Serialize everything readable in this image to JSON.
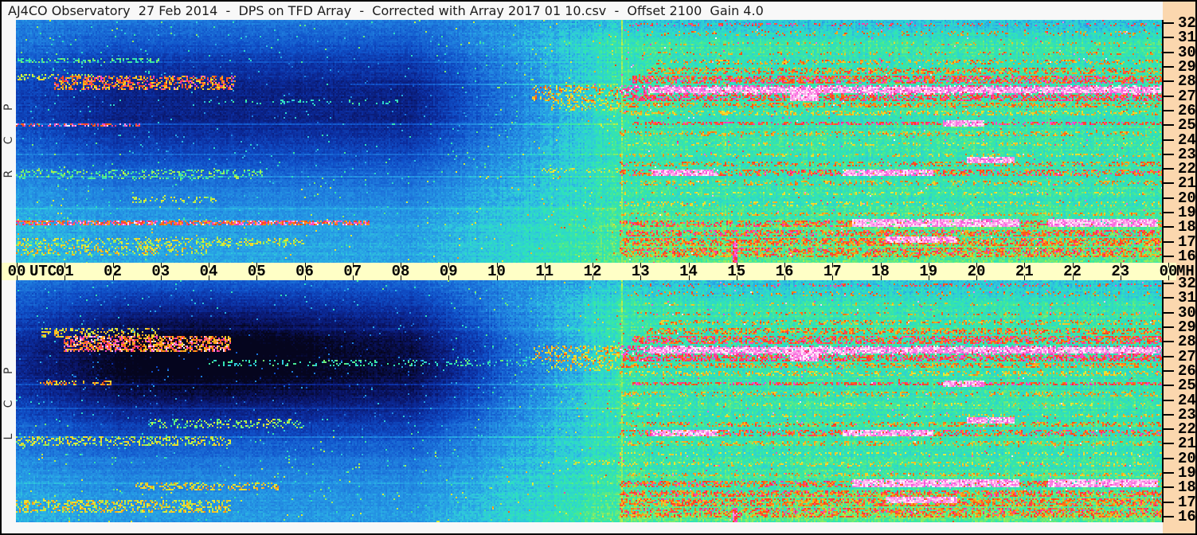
{
  "window": {
    "title": "AJ4CO Observatory  27 Feb 2014  -  DPS on TFD Array  -  Corrected with Array 2017 01 10.csv  -  Offset 2100  Gain 4.0"
  },
  "time_axis": {
    "utc_label": "UTC",
    "hour_labels": [
      "00",
      "01",
      "02",
      "03",
      "04",
      "05",
      "06",
      "07",
      "08",
      "09",
      "10",
      "11",
      "12",
      "13",
      "14",
      "15",
      "16",
      "17",
      "18",
      "19",
      "20",
      "21",
      "22",
      "23",
      "00"
    ]
  },
  "freq_axis": {
    "unit_label": "MHz",
    "tick_labels": [
      "32",
      "31",
      "30",
      "29",
      "28",
      "27",
      "26",
      "25",
      "24",
      "23",
      "22",
      "21",
      "20",
      "19",
      "18",
      "17",
      "16"
    ]
  },
  "colors": {
    "border": "#000000",
    "page_bg": "#f8f8f8",
    "time_band_bg": "#ffffc6",
    "right_margin_bg": "#fbd7ae",
    "axis_text": "#000000",
    "title_text": "#1c1c1c"
  },
  "chart_data": {
    "type": "heatmap",
    "title": "Dual-polarization dynamic power spectrum, 16-32 MHz over 24 h UTC",
    "date": "27 Feb 2014",
    "x": {
      "label": "UTC",
      "min_hours": 0,
      "max_hours": 24,
      "tick_step_hours": 1
    },
    "y": {
      "label": "MHz",
      "min": 16,
      "max": 32,
      "tick_step": 1
    },
    "colormap": [
      [
        0,
        "#05051e"
      ],
      [
        0.08,
        "#0a1464"
      ],
      [
        0.16,
        "#0c2d9e"
      ],
      [
        0.24,
        "#1050c8"
      ],
      [
        0.32,
        "#1e78dc"
      ],
      [
        0.4,
        "#28a0e6"
      ],
      [
        0.46,
        "#30c8dc"
      ],
      [
        0.52,
        "#2ee0c0"
      ],
      [
        0.57,
        "#3ce89e"
      ],
      [
        0.62,
        "#7aec6e"
      ],
      [
        0.67,
        "#b4ee4a"
      ],
      [
        0.72,
        "#e8ee38"
      ],
      [
        0.77,
        "#f8d028"
      ],
      [
        0.82,
        "#fca41e"
      ],
      [
        0.86,
        "#fc7014"
      ],
      [
        0.9,
        "#fc3c1e"
      ],
      [
        0.93,
        "#f83ca0"
      ],
      [
        0.96,
        "#fa50d8"
      ],
      [
        1,
        "#ffffff"
      ]
    ],
    "night_ionosphere": {
      "fade_in_end_utc": 2.2,
      "flat_end_utc": 8.3,
      "fade_out_end_utc": 12.62,
      "freq_center_mhz": 26.5,
      "freq_width_mhz": 5.5
    },
    "vertical_line_utc": 12.68,
    "rfi_bands": [
      [
        31.9,
        0.15,
        0.22,
        0.85,
        0.95,
        12.8
      ],
      [
        31.3,
        0.12,
        0.14,
        0.78,
        0.9,
        12.8
      ],
      [
        30.6,
        0.12,
        0.12,
        0.75,
        0.88,
        13.0
      ],
      [
        29.9,
        0.12,
        0.18,
        0.78,
        0.9,
        13.0
      ],
      [
        29.3,
        0.15,
        0.3,
        0.75,
        0.9,
        13.4
      ],
      [
        28.75,
        0.2,
        0.45,
        0.78,
        0.92,
        13.2
      ],
      [
        28.15,
        0.3,
        0.6,
        0.82,
        0.96,
        12.9
      ],
      [
        27.4,
        0.3,
        0.5,
        0.9,
        1.0,
        12.62
      ],
      [
        26.9,
        0.2,
        0.6,
        0.85,
        0.96,
        12.7
      ],
      [
        26.35,
        0.18,
        0.45,
        0.78,
        0.9,
        12.62
      ],
      [
        25.8,
        0.15,
        0.35,
        0.72,
        0.85,
        12.62
      ],
      [
        25.15,
        0.12,
        0.5,
        0.85,
        0.96,
        12.9
      ],
      [
        24.45,
        0.15,
        0.3,
        0.75,
        0.88,
        12.62
      ],
      [
        23.7,
        0.12,
        0.2,
        0.7,
        0.82,
        12.62
      ],
      [
        22.9,
        0.12,
        0.25,
        0.72,
        0.85,
        12.62
      ],
      [
        22.35,
        0.15,
        0.35,
        0.78,
        0.92,
        12.62
      ],
      [
        21.7,
        0.2,
        0.45,
        0.8,
        0.95,
        12.62
      ],
      [
        21.05,
        0.15,
        0.3,
        0.75,
        0.88,
        12.62
      ],
      [
        20.3,
        0.12,
        0.2,
        0.7,
        0.8,
        12.62
      ],
      [
        19.6,
        0.12,
        0.2,
        0.72,
        0.82,
        12.62
      ],
      [
        18.9,
        0.15,
        0.3,
        0.75,
        0.88,
        12.62
      ],
      [
        18.25,
        0.2,
        0.5,
        0.8,
        0.95,
        12.62
      ],
      [
        17.6,
        0.25,
        0.55,
        0.8,
        0.95,
        12.62
      ],
      [
        17.0,
        0.25,
        0.6,
        0.78,
        0.93,
        12.62
      ],
      [
        16.4,
        0.2,
        0.5,
        0.8,
        0.95,
        12.62
      ],
      [
        16.05,
        0.15,
        0.5,
        0.78,
        0.92,
        12.62
      ]
    ],
    "white_segments": [
      [
        27.4,
        13.25,
        23.97
      ],
      [
        21.75,
        13.3,
        14.7
      ],
      [
        21.75,
        17.3,
        19.2
      ],
      [
        18.3,
        17.5,
        21.0
      ],
      [
        18.3,
        21.6,
        23.9
      ],
      [
        17.15,
        18.2,
        19.7
      ],
      [
        22.6,
        19.9,
        20.9
      ],
      [
        25.1,
        19.4,
        20.25
      ],
      [
        26.9,
        16.2,
        16.8
      ]
    ],
    "panels": [
      {
        "name": "RCP",
        "label": "R C P",
        "seed": 1234567,
        "night_depth": 0.42,
        "extra_core_depth": 0,
        "lines": [
          [
            25.05,
            0,
            12.6,
            0.1
          ],
          [
            21.5,
            0,
            12.6,
            0.08
          ],
          [
            23.0,
            0,
            12.6,
            0.05
          ],
          [
            27.75,
            7,
            12.6,
            0.08
          ],
          [
            29.35,
            0,
            12.6,
            0.05
          ],
          [
            19.3,
            0,
            12.6,
            0.05
          ]
        ],
        "streaks": [
          [
            27.9,
            0.5,
            0.8,
            4.6,
            0.5,
            0.72,
            0.97
          ],
          [
            28.3,
            0.25,
            0.0,
            1.6,
            0.3,
            0.6,
            0.8
          ],
          [
            25.0,
            0.12,
            0.0,
            2.6,
            0.5,
            0.85,
            1.0
          ],
          [
            21.6,
            0.3,
            0.0,
            5.2,
            0.28,
            0.5,
            0.68
          ],
          [
            18.3,
            0.14,
            0.0,
            7.4,
            0.7,
            0.8,
            1.0
          ],
          [
            17.0,
            0.3,
            0.0,
            6.0,
            0.3,
            0.6,
            0.8
          ],
          [
            16.4,
            0.3,
            0.0,
            4.0,
            0.3,
            0.6,
            0.85
          ],
          [
            19.9,
            0.2,
            2.4,
            4.2,
            0.25,
            0.6,
            0.75
          ],
          [
            29.4,
            0.15,
            0.0,
            3.0,
            0.35,
            0.5,
            0.65
          ],
          [
            26.6,
            0.2,
            4.0,
            8.0,
            0.12,
            0.45,
            0.6
          ],
          [
            27.2,
            0.5,
            10.8,
            12.62,
            0.35,
            0.68,
            0.9
          ],
          [
            26.3,
            0.35,
            11.2,
            12.62,
            0.3,
            0.65,
            0.85
          ],
          [
            21.9,
            0.2,
            11.0,
            12.62,
            0.25,
            0.6,
            0.8
          ]
        ],
        "burst": [
          15.05,
          0.05,
          17.0
        ]
      },
      {
        "name": "LCP",
        "label": "L C P",
        "seed": 7654321,
        "night_depth": 0.5,
        "extra_core_depth": 0.1,
        "lines": [
          [
            25.05,
            0,
            12.6,
            0.08
          ],
          [
            21.5,
            0,
            12.6,
            0.07
          ],
          [
            28.9,
            0,
            12.6,
            0.05
          ],
          [
            23.4,
            0,
            12.6,
            0.05
          ],
          [
            18.3,
            0,
            12.6,
            0.06
          ]
        ],
        "streaks": [
          [
            27.9,
            0.55,
            1.0,
            4.5,
            0.6,
            0.75,
            1.0
          ],
          [
            28.6,
            0.3,
            0.5,
            3.0,
            0.35,
            0.65,
            0.85
          ],
          [
            25.2,
            0.15,
            0.5,
            2.0,
            0.35,
            0.7,
            0.9
          ],
          [
            21.2,
            0.3,
            0.0,
            4.5,
            0.35,
            0.6,
            0.8
          ],
          [
            16.7,
            0.45,
            0.0,
            4.5,
            0.4,
            0.62,
            0.85
          ],
          [
            18.1,
            0.25,
            2.5,
            5.5,
            0.35,
            0.65,
            0.85
          ],
          [
            26.55,
            0.25,
            4.0,
            11.5,
            0.2,
            0.45,
            0.62
          ],
          [
            22.4,
            0.3,
            2.8,
            6.0,
            0.25,
            0.55,
            0.75
          ],
          [
            27.2,
            0.5,
            10.8,
            12.62,
            0.35,
            0.68,
            0.9
          ],
          [
            26.3,
            0.35,
            11.2,
            12.62,
            0.3,
            0.65,
            0.85
          ],
          [
            19.7,
            0.2,
            11.5,
            12.62,
            0.25,
            0.6,
            0.78
          ]
        ],
        "burst": [
          15.05,
          0.04,
          16.6
        ]
      }
    ]
  }
}
